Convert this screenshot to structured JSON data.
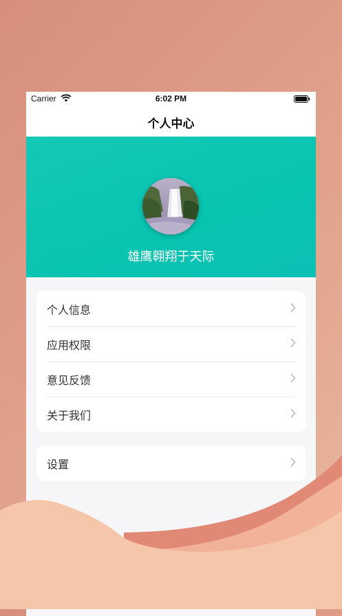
{
  "status_bar": {
    "carrier": "Carrier",
    "time": "6:02 PM"
  },
  "nav": {
    "title": "个人中心"
  },
  "profile": {
    "username": "雄鹰翱翔于天际"
  },
  "menu_group_1": [
    {
      "label": "个人信息"
    },
    {
      "label": "应用权限"
    },
    {
      "label": "意见反馈"
    },
    {
      "label": "关于我们"
    }
  ],
  "menu_group_2": [
    {
      "label": "设置"
    }
  ],
  "colors": {
    "accent": "#07c4b0",
    "background": "#d78e7d"
  },
  "icons": {
    "wifi": "wifi-icon",
    "battery": "battery-icon",
    "chevron": "chevron-right-icon"
  }
}
